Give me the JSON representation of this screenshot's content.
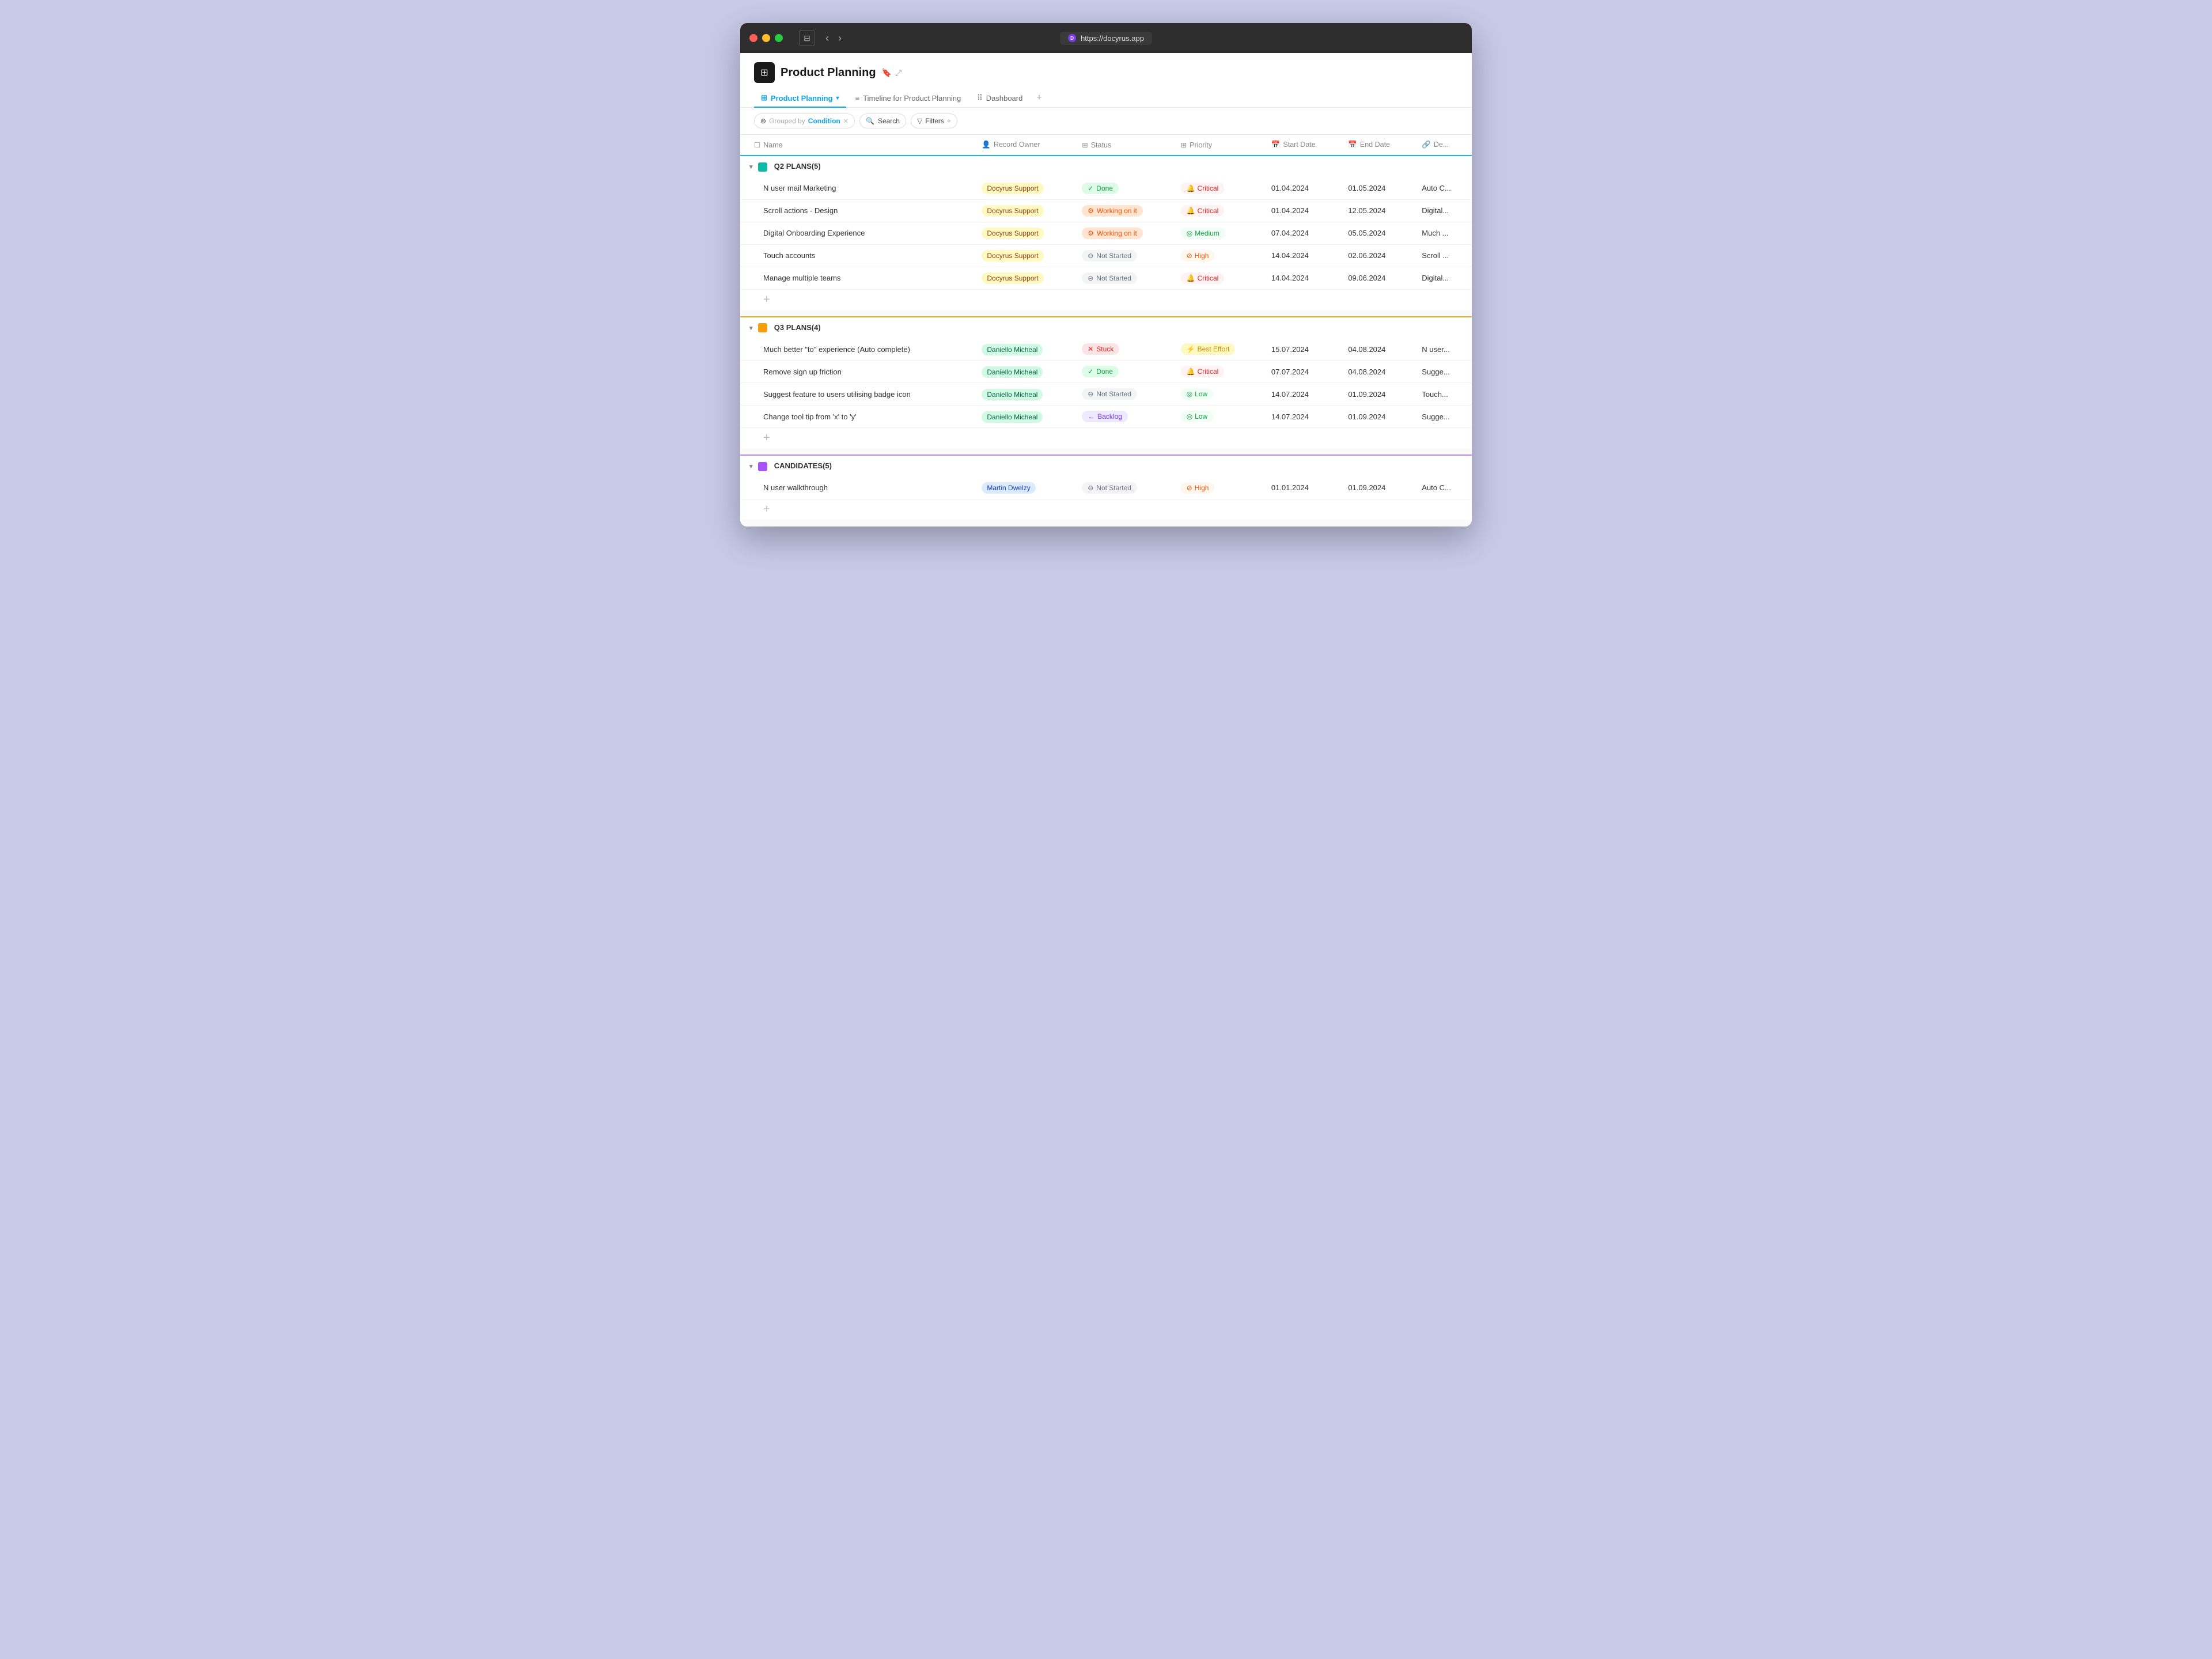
{
  "window": {
    "traffic_lights": [
      "red",
      "yellow",
      "green"
    ],
    "url": "https://docyrus.app",
    "url_favicon": "D"
  },
  "titlebar": {
    "back_label": "‹",
    "forward_label": "›",
    "sidebar_icon": "⊟"
  },
  "header": {
    "page_icon": "⊞",
    "page_title": "Product Planning",
    "bookmark_icon": "🔖",
    "expand_icon": "⤢",
    "tabs": [
      {
        "label": "Product Planning",
        "icon": "⊞",
        "active": true
      },
      {
        "label": "Timeline for Product Planning",
        "icon": "≡",
        "active": false
      },
      {
        "label": "Dashboard",
        "icon": "⠿",
        "active": false
      }
    ],
    "tab_add": "+"
  },
  "toolbar": {
    "grouped_by_label": "Grouped by",
    "grouped_by_value": "Condition",
    "search_label": "Search",
    "filters_label": "Filters",
    "filter_add": "+"
  },
  "table": {
    "columns": [
      {
        "label": "Name",
        "icon": "☐"
      },
      {
        "label": "Record Owner",
        "icon": "👤"
      },
      {
        "label": "Status",
        "icon": "⊞"
      },
      {
        "label": "Priority",
        "icon": "⊞"
      },
      {
        "label": "Start Date",
        "icon": "📅"
      },
      {
        "label": "End Date",
        "icon": "📅"
      },
      {
        "label": "De...",
        "icon": "🔗"
      }
    ]
  },
  "groups": [
    {
      "id": "q2",
      "color_class": "dot-teal",
      "label": "Q2 PLANS",
      "count": 5,
      "rows": [
        {
          "name": "N user mail Marketing",
          "owner": "Docyrus Support",
          "owner_style": "yellow",
          "status": "Done",
          "status_class": "done",
          "status_icon": "✓",
          "priority": "Critical",
          "priority_class": "critical",
          "priority_icon": "🔔",
          "start_date": "01.04.2024",
          "end_date": "01.05.2024",
          "desc": "Auto C..."
        },
        {
          "name": "Scroll actions - Design",
          "owner": "Docyrus Support",
          "owner_style": "yellow",
          "status": "Working on it",
          "status_class": "working",
          "status_icon": "⚙",
          "priority": "Critical",
          "priority_class": "critical",
          "priority_icon": "🔔",
          "start_date": "01.04.2024",
          "end_date": "12.05.2024",
          "desc": "Digital..."
        },
        {
          "name": "Digital Onboarding Experience",
          "owner": "Docyrus Support",
          "owner_style": "yellow",
          "status": "Working on it",
          "status_class": "working",
          "status_icon": "⚙",
          "priority": "Medium",
          "priority_class": "medium",
          "priority_icon": "◎",
          "start_date": "07.04.2024",
          "end_date": "05.05.2024",
          "desc": "Much ..."
        },
        {
          "name": "Touch accounts",
          "owner": "Docyrus Support",
          "owner_style": "yellow",
          "status": "Not Started",
          "status_class": "not-started",
          "status_icon": "⊖",
          "priority": "High",
          "priority_class": "high",
          "priority_icon": "⊘",
          "start_date": "14.04.2024",
          "end_date": "02.06.2024",
          "desc": "Scroll ..."
        },
        {
          "name": "Manage multiple teams",
          "owner": "Docyrus Support",
          "owner_style": "yellow",
          "status": "Not Started",
          "status_class": "not-started",
          "status_icon": "⊖",
          "priority": "Critical",
          "priority_class": "critical",
          "priority_icon": "🔔",
          "start_date": "14.04.2024",
          "end_date": "09.06.2024",
          "desc": "Digital..."
        }
      ]
    },
    {
      "id": "q3",
      "color_class": "dot-orange",
      "label": "Q3 PLANS",
      "count": 4,
      "rows": [
        {
          "name": "Much better \"to\" experience (Auto complete)",
          "owner": "Daniello Micheal",
          "owner_style": "green",
          "status": "Stuck",
          "status_class": "stuck",
          "status_icon": "✕",
          "priority": "Best Effort",
          "priority_class": "best-effort",
          "priority_icon": "⚡",
          "start_date": "15.07.2024",
          "end_date": "04.08.2024",
          "desc": "N user..."
        },
        {
          "name": "Remove sign up friction",
          "owner": "Daniello Micheal",
          "owner_style": "green",
          "status": "Done",
          "status_class": "done",
          "status_icon": "✓",
          "priority": "Critical",
          "priority_class": "critical",
          "priority_icon": "🔔",
          "start_date": "07.07.2024",
          "end_date": "04.08.2024",
          "desc": "Sugge..."
        },
        {
          "name": "Suggest feature to users utilising badge icon",
          "owner": "Daniello Micheal",
          "owner_style": "green",
          "status": "Not Started",
          "status_class": "not-started",
          "status_icon": "⊖",
          "priority": "Low",
          "priority_class": "low",
          "priority_icon": "◎",
          "start_date": "14.07.2024",
          "end_date": "01.09.2024",
          "desc": "Touch..."
        },
        {
          "name": "Change tool tip from 'x' to 'y'",
          "owner": "Daniello Micheal",
          "owner_style": "green",
          "status": "Backlog",
          "status_class": "backlog",
          "status_icon": "←",
          "priority": "Low",
          "priority_class": "low",
          "priority_icon": "◎",
          "start_date": "14.07.2024",
          "end_date": "01.09.2024",
          "desc": "Sugge..."
        }
      ]
    },
    {
      "id": "candidates",
      "color_class": "dot-purple",
      "label": "CANDIDATES",
      "count": 5,
      "rows": [
        {
          "name": "N user walkthrough",
          "owner": "Martin Dwelzy",
          "owner_style": "blue",
          "status": "Not Started",
          "status_class": "not-started",
          "status_icon": "⊖",
          "priority": "High",
          "priority_class": "high",
          "priority_icon": "⊘",
          "start_date": "01.01.2024",
          "end_date": "01.09.2024",
          "desc": "Auto C..."
        }
      ]
    }
  ]
}
